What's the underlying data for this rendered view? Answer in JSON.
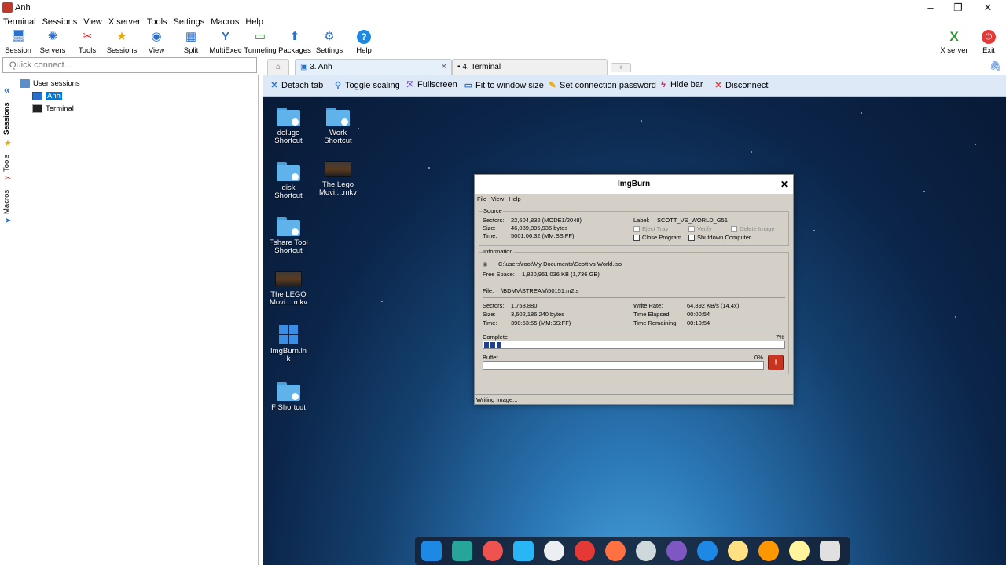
{
  "window": {
    "title": "Anh"
  },
  "menu": [
    "Terminal",
    "Sessions",
    "View",
    "X server",
    "Tools",
    "Settings",
    "Macros",
    "Help"
  ],
  "toolbar": [
    {
      "label": "Session",
      "icon": "session-icon",
      "color": "#2a6fc9",
      "glyph": "🖥"
    },
    {
      "label": "Servers",
      "icon": "servers-icon",
      "color": "#2a6fc9",
      "glyph": "✺"
    },
    {
      "label": "Tools",
      "icon": "tools-icon",
      "color": "#d32f2f",
      "glyph": "✂"
    },
    {
      "label": "Sessions",
      "icon": "star-icon",
      "color": "#e6a800",
      "glyph": "★"
    },
    {
      "label": "View",
      "icon": "view-icon",
      "color": "#2a6fc9",
      "glyph": "◉"
    },
    {
      "label": "Split",
      "icon": "split-icon",
      "color": "#2a6fc9",
      "glyph": "▦"
    },
    {
      "label": "MultiExec",
      "icon": "multiexec-icon",
      "color": "#2a6fc9",
      "glyph": "Y"
    },
    {
      "label": "Tunneling",
      "icon": "tunneling-icon",
      "color": "#2f9a2f",
      "glyph": "▭"
    },
    {
      "label": "Packages",
      "icon": "packages-icon",
      "color": "#2a6fc9",
      "glyph": "⬆"
    },
    {
      "label": "Settings",
      "icon": "settings-icon",
      "color": "#2a6fc9",
      "glyph": "⚙"
    },
    {
      "label": "Help",
      "icon": "help-icon",
      "color": "#2a6fc9",
      "glyph": "?"
    }
  ],
  "right_toolbar": {
    "xserver": "X server",
    "exit": "Exit"
  },
  "quick_connect": {
    "placeholder": "Quick connect..."
  },
  "side_tabs": {
    "sessions": "Sessions",
    "tools": "Tools",
    "macros": "Macros"
  },
  "session_tree": {
    "root": "User sessions",
    "items": [
      "Anh",
      "Terminal"
    ]
  },
  "tabs": {
    "t1": "3. Anh",
    "t2": "4. Terminal"
  },
  "actions": {
    "detach": "Detach tab",
    "toggle": "Toggle scaling",
    "fullscreen": "Fullscreen",
    "fit": "Fit to window size",
    "password": "Set connection password",
    "hide": "Hide bar",
    "disconnect": "Disconnect"
  },
  "desktop_icons": [
    {
      "line1": "deluge",
      "line2": "Shortcut"
    },
    {
      "line1": "Work",
      "line2": "Shortcut"
    },
    {
      "line1": "disk",
      "line2": "Shortcut"
    },
    {
      "line1": "The Lego",
      "line2": "Movi....mkv"
    },
    {
      "line1": "Fshare Tool",
      "line2": "Shortcut"
    },
    {
      "line1": "The LEGO",
      "line2": "Movi....mkv"
    },
    {
      "line1": "ImgBurn.ln",
      "line2": "k"
    },
    {
      "line1": "F Shortcut",
      "line2": ""
    }
  ],
  "imgburn": {
    "title": "ImgBurn",
    "menu": [
      "File",
      "View",
      "Help"
    ],
    "source": {
      "group": "Source",
      "sectors_label": "Sectors:",
      "sectors": "22,504,832 (MODE1/2048)",
      "size_label": "Size:",
      "size": "46,089,895,936 bytes",
      "time_label": "Time:",
      "time": "5001:06:32 (MM:SS:FF)",
      "label_label": "Label:",
      "label": "SCOTT_VS_WORLD_G51",
      "eject": "Eject Tray",
      "verify": "Verify",
      "delete": "Delete Image",
      "close": "Close Program",
      "shutdown": "Shutdown Computer"
    },
    "info": {
      "group": "Information",
      "path": "C:\\users\\root\\My Documents\\Scott vs World.iso",
      "free_label": "Free Space:",
      "free": "1,820,951,036 KB  (1,736 GB)",
      "file_label": "File:",
      "file": "\\BDMV\\STREAM\\50151.m2ts",
      "sectors_label": "Sectors:",
      "sectors": "1,758,880",
      "size_label": "Size:",
      "size": "3,602,186,240 bytes",
      "time_label": "Time:",
      "time": "390:53:55 (MM:SS:FF)",
      "rate_label": "Write Rate:",
      "rate": "64,892 KB/s (14.4x)",
      "elapsed_label": "Time Elapsed:",
      "elapsed": "00:00:54",
      "remaining_label": "Time Remaining:",
      "remaining": "00:10:54"
    },
    "complete_label": "Complete",
    "complete_pct": "7%",
    "complete_value": 0.07,
    "buffer_label": "Buffer",
    "buffer_pct": "0%",
    "buffer_value": 0.0,
    "status": "Writing Image..."
  },
  "dock_colors": [
    "#1e88e5",
    "#26a69a",
    "#ef5350",
    "#29b6f6",
    "#eceff1",
    "#e53935",
    "#ff7043",
    "#cfd8dc",
    "#7e57c2",
    "#1e88e5",
    "#ffe082",
    "#ff9800",
    "#fff59d",
    "#e0e0e0"
  ],
  "colors": {
    "actionbar": "#dde9f7",
    "selected": "#0078d7"
  }
}
